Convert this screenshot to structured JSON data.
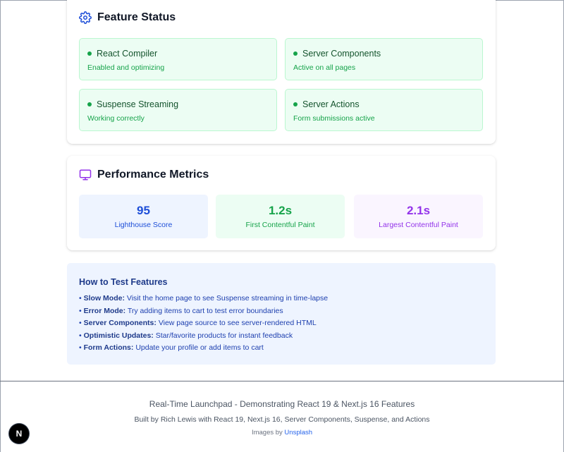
{
  "colors": {
    "accent_blue": "#1d4ed8",
    "success_green": "#16a34a",
    "purple": "#9333ea",
    "status_bg": "#ecfdf3",
    "howto_bg": "#eef4ff"
  },
  "feature_status": {
    "icon": "gear-icon",
    "title": "Feature Status",
    "items": [
      {
        "name": "React Compiler",
        "description": "Enabled and optimizing"
      },
      {
        "name": "Server Components",
        "description": "Active on all pages"
      },
      {
        "name": "Suspense Streaming",
        "description": "Working correctly"
      },
      {
        "name": "Server Actions",
        "description": "Form submissions active"
      }
    ]
  },
  "performance": {
    "icon": "monitor-icon",
    "title": "Performance Metrics",
    "metrics": [
      {
        "value": "95",
        "label": "Lighthouse Score",
        "color": "#1d4ed8",
        "bg": "#eef4ff"
      },
      {
        "value": "1.2s",
        "label": "First Contentful Paint",
        "color": "#16a34a",
        "bg": "#ecfdf3"
      },
      {
        "value": "2.1s",
        "label": "Largest Contentful Paint",
        "color": "#9333ea",
        "bg": "#faf5ff"
      }
    ]
  },
  "how_to": {
    "title": "How to Test Features",
    "items": [
      {
        "bullet": "•",
        "term": "Slow Mode:",
        "text": "Visit the home page to see Suspense streaming in time-lapse"
      },
      {
        "bullet": "•",
        "term": "Error Mode:",
        "text": "Try adding items to cart to test error boundaries"
      },
      {
        "bullet": "•",
        "term": "Server Components:",
        "text": "View page source to see server-rendered HTML"
      },
      {
        "bullet": "•",
        "term": "Optimistic Updates:",
        "text": "Star/favorite products for instant feedback"
      },
      {
        "bullet": "•",
        "term": "Form Actions:",
        "text": "Update your profile or add items to cart"
      }
    ]
  },
  "footer": {
    "tagline": "Real-Time Launchpad - Demonstrating React 19 & Next.js 16 Features",
    "credits": "Built by Rich Lewis with React 19, Next.js 16, Server Components, Suspense, and Actions",
    "images_prefix": "Images by",
    "images_link": "Unsplash"
  },
  "next_badge": {
    "letter": "N"
  }
}
